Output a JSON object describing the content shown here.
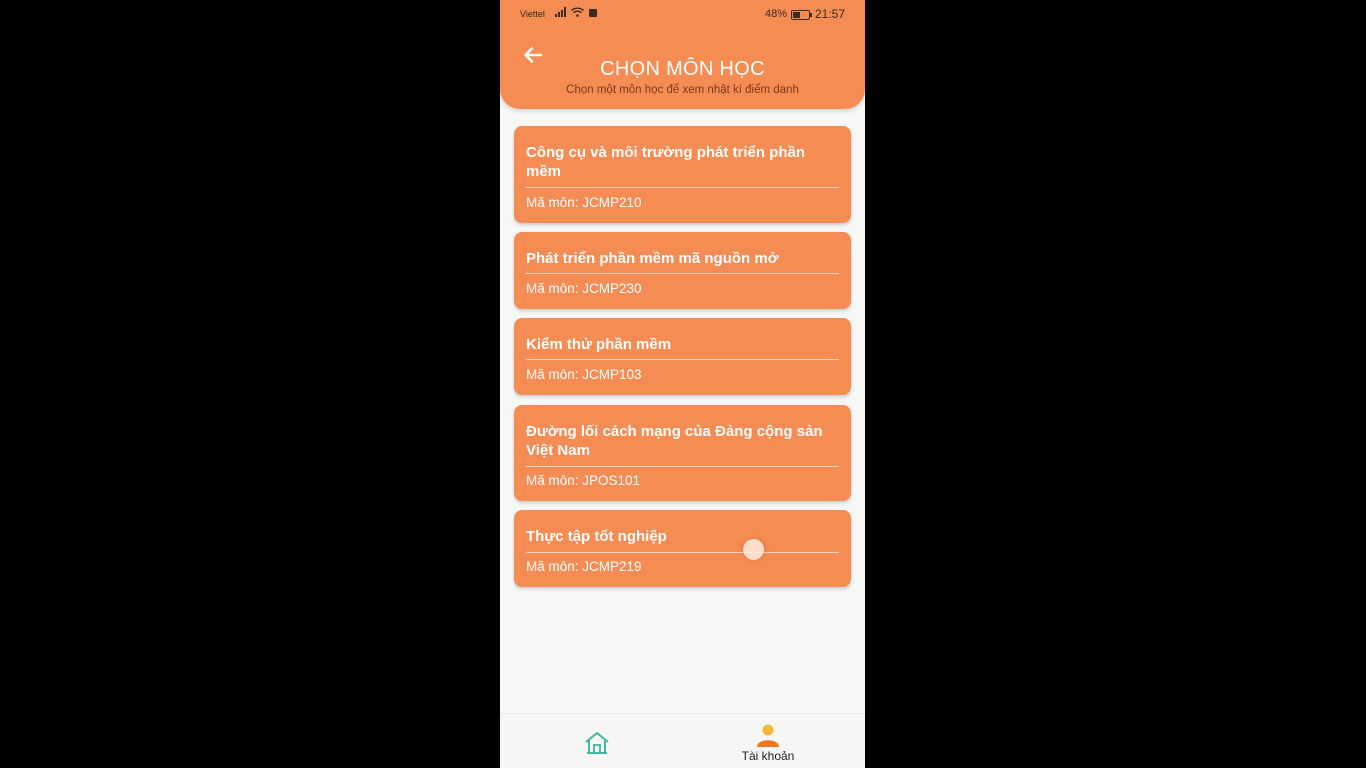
{
  "status_bar": {
    "carrier": "Viettel",
    "battery_percent": "48%",
    "battery_level": 0.48,
    "time": "21:57"
  },
  "header": {
    "title": "CHỌN MÔN HỌC",
    "subtitle": "Chọn một môn học để xem nhật kí điểm danh",
    "back_icon": "arrow-left-icon"
  },
  "courses": [
    {
      "name": "Công cụ và môi trường phát triển phần mềm",
      "code_label": "Mã môn: JCMP210"
    },
    {
      "name": "Phát triển phần mềm mã nguồn mở",
      "code_label": "Mã môn: JCMP230"
    },
    {
      "name": "Kiểm thử phần mềm",
      "code_label": "Mã môn: JCMP103"
    },
    {
      "name": "Đường lối cách mạng của Đảng cộng sản Việt Nam",
      "code_label": "Mã môn: JPOS101"
    },
    {
      "name": "Thực tập tốt nghiệp",
      "code_label": "Mã môn: JCMP219"
    }
  ],
  "bottom_nav": {
    "home_icon": "home-icon",
    "account_icon": "user-avatar-icon",
    "account_label": "Tài khoản"
  },
  "colors": {
    "accent": "#f58c54",
    "home_icon": "#3fb9a2",
    "account_icon": "#f59a1e"
  }
}
